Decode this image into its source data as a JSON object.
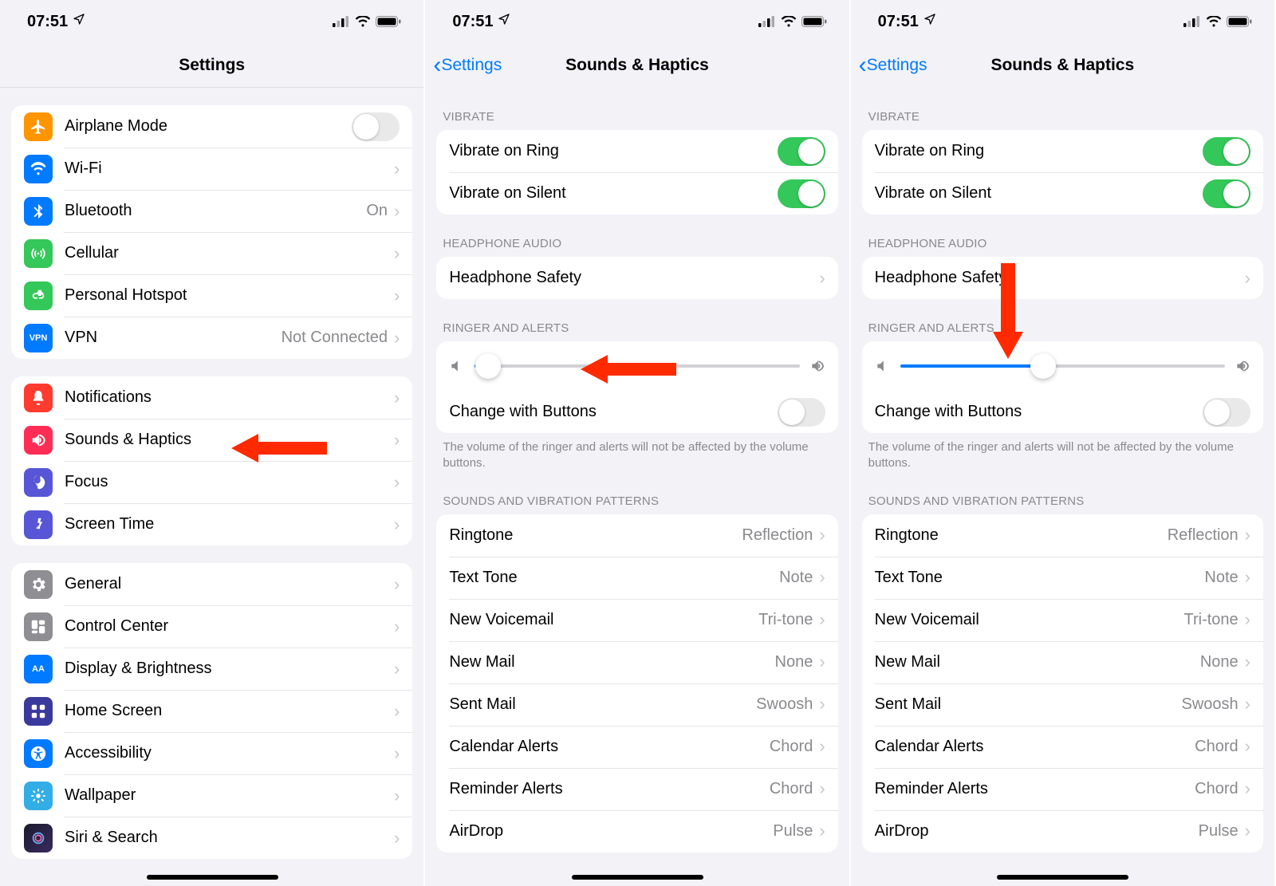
{
  "statusbar": {
    "time": "07:51"
  },
  "phone1": {
    "title": "Settings",
    "group1": [
      {
        "name": "airplane-mode",
        "label": "Airplane Mode",
        "iconColor": "ic-orange",
        "toggle": false
      },
      {
        "name": "wifi",
        "label": "Wi-Fi",
        "iconColor": "ic-blue",
        "value": "",
        "chevron": true
      },
      {
        "name": "bluetooth",
        "label": "Bluetooth",
        "iconColor": "ic-blue",
        "value": "On",
        "chevron": true
      },
      {
        "name": "cellular",
        "label": "Cellular",
        "iconColor": "ic-green",
        "chevron": true
      },
      {
        "name": "personal-hotspot",
        "label": "Personal Hotspot",
        "iconColor": "ic-green",
        "chevron": true
      },
      {
        "name": "vpn",
        "label": "VPN",
        "iconColor": "ic-blue",
        "iconText": "VPN",
        "value": "Not Connected",
        "chevron": true
      }
    ],
    "group2": [
      {
        "name": "notifications",
        "label": "Notifications",
        "iconColor": "ic-red",
        "chevron": true
      },
      {
        "name": "sounds-haptics",
        "label": "Sounds & Haptics",
        "iconColor": "ic-redP",
        "chevron": true
      },
      {
        "name": "focus",
        "label": "Focus",
        "iconColor": "ic-indigo",
        "chevron": true
      },
      {
        "name": "screen-time",
        "label": "Screen Time",
        "iconColor": "ic-indigo",
        "chevron": true
      }
    ],
    "group3": [
      {
        "name": "general",
        "label": "General",
        "iconColor": "ic-gray",
        "chevron": true
      },
      {
        "name": "control-center",
        "label": "Control Center",
        "iconColor": "ic-gray",
        "chevron": true
      },
      {
        "name": "display-brightness",
        "label": "Display & Brightness",
        "iconColor": "ic-blue",
        "iconText": "AA",
        "chevron": true
      },
      {
        "name": "home-screen",
        "label": "Home Screen",
        "iconColor": "ic-homescreen",
        "chevron": true
      },
      {
        "name": "accessibility",
        "label": "Accessibility",
        "iconColor": "ic-blue",
        "chevron": true
      },
      {
        "name": "wallpaper",
        "label": "Wallpaper",
        "iconColor": "ic-cyan",
        "chevron": true
      },
      {
        "name": "siri-search",
        "label": "Siri & Search",
        "iconColor": "ic-siri",
        "chevron": true
      }
    ]
  },
  "sounds": {
    "backLabel": "Settings",
    "title": "Sounds & Haptics",
    "sections": {
      "vibrateHeader": "VIBRATE",
      "vibrateRows": [
        {
          "name": "vibrate-on-ring",
          "label": "Vibrate on Ring",
          "toggle": true
        },
        {
          "name": "vibrate-on-silent",
          "label": "Vibrate on Silent",
          "toggle": true
        }
      ],
      "headphoneHeader": "HEADPHONE AUDIO",
      "headphoneRow": {
        "name": "headphone-safety",
        "label": "Headphone Safety"
      },
      "ringerHeader": "RINGER AND ALERTS",
      "changeWithButtons": {
        "label": "Change with Buttons",
        "toggle": false
      },
      "ringerFooter": "The volume of the ringer and alerts will not be affected by the volume buttons.",
      "patternsHeader": "SOUNDS AND VIBRATION PATTERNS",
      "patterns": [
        {
          "name": "ringtone",
          "label": "Ringtone",
          "value": "Reflection"
        },
        {
          "name": "text-tone",
          "label": "Text Tone",
          "value": "Note"
        },
        {
          "name": "new-voicemail",
          "label": "New Voicemail",
          "value": "Tri-tone"
        },
        {
          "name": "new-mail",
          "label": "New Mail",
          "value": "None"
        },
        {
          "name": "sent-mail",
          "label": "Sent Mail",
          "value": "Swoosh"
        },
        {
          "name": "calendar-alerts",
          "label": "Calendar Alerts",
          "value": "Chord"
        },
        {
          "name": "reminder-alerts",
          "label": "Reminder Alerts",
          "value": "Chord"
        },
        {
          "name": "airdrop",
          "label": "AirDrop",
          "value": "Pulse"
        }
      ]
    },
    "sliderA": 4,
    "sliderB": 44
  }
}
